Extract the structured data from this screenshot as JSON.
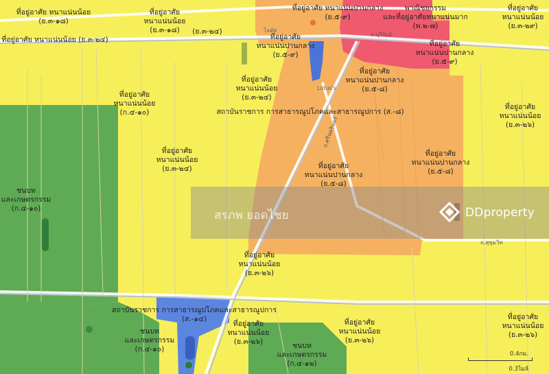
{
  "zones": {
    "z1": [
      "ที่อยู่อาศัย หนาแน่นน้อย",
      "(ย.๓-๑๘)"
    ],
    "z2": [
      "ที่อยู่อาศัย",
      "หนาแน่นน้อย",
      "(ย.๓-๑๘)"
    ],
    "z3": [
      "ที่อยู่อาศัย หนาแน่นน้อย (ย.๓-๒๔)"
    ],
    "z4": [
      "(ย.๓-๒๔)"
    ],
    "z5": [
      "ที่อยู่อาศัย",
      "หนาแน่นปานกลาง",
      "(ย.๕-๙)"
    ],
    "z6": [
      "ที่อยู่อาศัย หนาแน่นปานกลาง",
      "(ย.๕-๙)"
    ],
    "z7": [
      "พาณิชยกรรม",
      "และที่อยู่อาศัยหนาแน่นมาก",
      "(พ.๒-๗)"
    ],
    "z8": [
      "ที่อยู่อาศัย",
      "หนาแน่นน้อย",
      "(ย.๓-๒๙)"
    ],
    "z9": [
      "ที่อยู่อาศัย",
      "หนาแน่นปานกลาง",
      "(ย.๕-๙)"
    ],
    "z10": [
      "ที่อยู่อาศัย",
      "หนาแน่นปานกลาง",
      "(ย.๕-๘)"
    ],
    "z11": [
      "ที่อยู่อาศัย",
      "หนาแน่นน้อย",
      "(ย.๓-๒๔)"
    ],
    "z12": [
      "ที่อยู่อาศัย",
      "หนาแน่นน้อย",
      "(ก.๔-๑๐)"
    ],
    "z13": [
      "สถาบันราชการ การสาธารณูปโภคและสาธารณูปการ (ส.-๘)"
    ],
    "z14": [
      "ที่อยู่อาศัย",
      "หนาแน่นน้อย",
      "(ย.๓-๒๖)"
    ],
    "z15": [
      "ที่อยู่อาศัย",
      "หนาแน่นน้อย",
      "(ย.๓-๒๔)"
    ],
    "z16": [
      "ที่อยู่อาศัย",
      "หนาแน่นปานกลาง",
      "(ย.๕-๘)"
    ],
    "z17": [
      "ที่อยู่อาศัย",
      "หนาแน่นปานกลาง",
      "(ย.๕-๘)"
    ],
    "z18": [
      "ชนบท",
      "และเกษตรกรรม",
      "(ก.๔-๑๐)"
    ],
    "z19": [
      "ที่อยู่อาศัย",
      "หนาแน่นน้อย",
      "(ย.๓-๒๖)"
    ],
    "z20": [
      "สถาบันราชการ การสาธารณูปโภคและสาธารณูปการ",
      "(ส.-๑๔)"
    ],
    "z21": [
      "ที่อยู่อาศัย",
      "หนาแน่นน้อย",
      "(ย.๓-๒๖)"
    ],
    "z22": [
      "ที่อยู่อาศัย",
      "หนาแน่นน้อย",
      "(ย.๓-๒๖)"
    ],
    "z23": [
      "ที่อยู่อาศัย",
      "หนาแน่นน้อย",
      "(ย.๓-๒๖)"
    ],
    "z24": [
      "ชนบท",
      "และเกษตรกรรม",
      "(ก.๔-๑๐)"
    ],
    "z25": [
      "ชนบท",
      "และเกษตรกรรม",
      "(ก.๔-๑๒)"
    ]
  },
  "roads": {
    "r1": "ถ.บุรีรัมย์",
    "r2": "ถ.ศรีนครินทร์",
    "r3": "ถ.สุขุมวิท"
  },
  "pois": {
    "p1": "โลตัส",
    "p2": "Lotus's"
  },
  "watermark": {
    "text": "สรภพ ยอดไชย",
    "brand": "DDproperty"
  },
  "scale": {
    "km": "0.4กม.",
    "mi": "0.3ไมล์"
  },
  "colors": {
    "low_density_residential": "#f7ef5a",
    "medium_density_residential": "#f5b15f",
    "commercial": "#ef5a6f",
    "rural_agricultural": "#5faa55",
    "institutional": "#5b86e0"
  }
}
